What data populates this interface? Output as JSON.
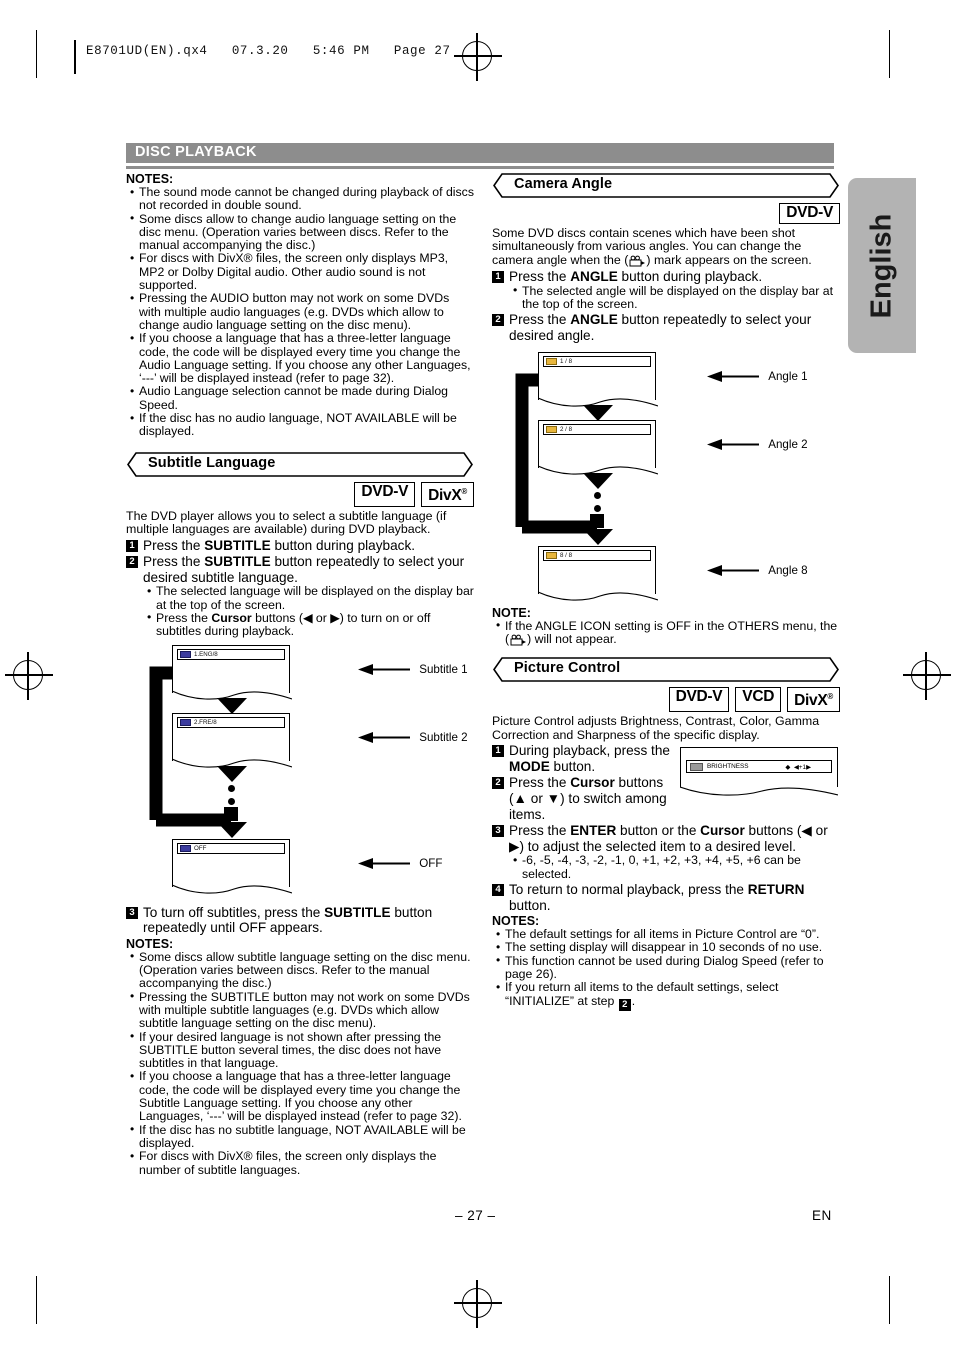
{
  "print_header": {
    "filename_line": "E8701UD(EN).qx4   07.3.20   5:46 PM   Page 27"
  },
  "side_tab": {
    "label": "English"
  },
  "section": {
    "banner_title": "DISC PLAYBACK"
  },
  "footer": {
    "page_number": "– 27 –",
    "language_code": "EN"
  },
  "left_column": {
    "notes_heading": "NOTES:",
    "audio_notes": [
      "The sound mode cannot be changed during playback of discs not recorded in double sound.",
      "Some discs allow to change audio language setting on the disc menu. (Operation varies between discs. Refer to the manual accompanying the disc.)",
      "For discs with DivX® files, the screen only displays MP3, MP2 or Dolby Digital audio. Other audio sound is not supported.",
      "Pressing the AUDIO button may not work on some DVDs with multiple audio languages (e.g. DVDs which allow to change audio language setting on the disc menu).",
      "If you choose a language that has a three-letter language code, the code will be displayed every time you change the Audio Language setting. If you choose any other Languages, ‘---’ will be displayed instead (refer to page 32).",
      "Audio Language selection cannot be made during Dialog Speed.",
      "If the disc has no audio language, NOT AVAILABLE will be displayed."
    ],
    "subtitle_section": {
      "title": "Subtitle Language",
      "badges": [
        "DVD-V",
        "DivX®"
      ],
      "intro": "The DVD player allows you to select a subtitle language (if multiple languages are available) during DVD playback.",
      "step1_num": "1",
      "step1": "Press the SUBTITLE button during playback.",
      "step2_num": "2",
      "step2": "Press the SUBTITLE button repeatedly to select your desired subtitle language.",
      "step2_bullets": [
        "The selected language will be displayed on the display bar at the top of the screen.",
        "Press the Cursor buttons (◀ or ▶) to turn on or off subtitles during playback."
      ],
      "step3_num": "3",
      "step3": "To turn off subtitles, press the SUBTITLE button repeatedly until OFF appears.",
      "diagram": {
        "screens": [
          {
            "osd": "1.ENG/8",
            "label": "Subtitle 1",
            "chip": "blue"
          },
          {
            "osd": "2.FRE/8",
            "label": "Subtitle 2",
            "chip": "blue"
          },
          {
            "osd": "OFF",
            "label": "OFF",
            "chip": "blue"
          }
        ]
      },
      "notes_heading": "NOTES:",
      "notes": [
        "Some discs allow subtitle language setting on the disc menu. (Operation varies between discs. Refer to the manual accompanying the disc.)",
        "Pressing the SUBTITLE button may not work on some DVDs with multiple subtitle languages (e.g. DVDs which allow subtitle language setting on the disc menu).",
        "If your desired language is not shown after pressing the SUBTITLE button several times, the disc does not have subtitles in that language.",
        "If you choose a language that has a three-letter language code, the code will be displayed every time you change the Subtitle Language setting. If you choose any other Languages, ‘---’ will be displayed instead (refer to page 32).",
        "If the disc has no subtitle language, NOT AVAILABLE will be displayed.",
        "For discs with DivX® files, the screen only displays the number of subtitle languages."
      ]
    }
  },
  "right_column": {
    "camera_angle_section": {
      "title": "Camera Angle",
      "badges": [
        "DVD-V"
      ],
      "intro": "Some DVD discs contain scenes which have been shot simultaneously from various angles. You can change the camera angle when the (  ) mark appears on the screen.",
      "step1_num": "1",
      "step1": "Press the ANGLE button during playback.",
      "step1_bullets": [
        "The selected angle will be displayed on the display bar at the top of the screen."
      ],
      "step2_num": "2",
      "step2": "Press the ANGLE button repeatedly to select your desired angle.",
      "diagram": {
        "screens": [
          {
            "osd": "1 / 8",
            "label": "Angle 1",
            "chip": "gold"
          },
          {
            "osd": "2 / 8",
            "label": "Angle 2",
            "chip": "gold"
          },
          {
            "osd": "8 / 8",
            "label": "Angle 8",
            "chip": "gold"
          }
        ]
      },
      "note_heading": "NOTE:",
      "notes": [
        "If the ANGLE ICON setting is OFF in the OTHERS menu, the (  ) will not appear."
      ]
    },
    "picture_control_section": {
      "title": "Picture Control",
      "badges": [
        "DVD-V",
        "VCD",
        "DivX®"
      ],
      "intro": "Picture Control adjusts Brightness, Contrast, Color, Gamma Correction and Sharpness of the specific display.",
      "step1_num": "1",
      "step1": "During playback, press the MODE button.",
      "step2_num": "2",
      "step2": "Press the Cursor buttons (▲ or ▼) to switch among items.",
      "step3_num": "3",
      "step3": "Press the ENTER button or the Cursor buttons (◀ or ▶) to adjust the selected item to a desired level.",
      "step3_bullets": [
        "-6, -5, -4, -3, -2, -1, 0, +1, +2, +3, +4, +5, +6 can be selected."
      ],
      "step4_num": "4",
      "step4": "To return to normal playback, press the RETURN button.",
      "osd_preview": {
        "label": "BRIGHTNESS",
        "value": "◀ + 1 ▶"
      },
      "notes_heading": "NOTES:",
      "notes": [
        "The default settings for all items in Picture Control are “0”.",
        "The setting display will disappear in 10 seconds of no use.",
        "This function cannot be used during Dialog Speed (refer to page 26).",
        "If you return all items to the default settings, select “INITIALIZE” at step 2."
      ]
    }
  },
  "colors": {
    "banner_gray": "#8d8d8d",
    "tab_gray": "#b3b3b3",
    "chip_blue": "#3b3b9e",
    "chip_gold": "#e8b63c"
  }
}
